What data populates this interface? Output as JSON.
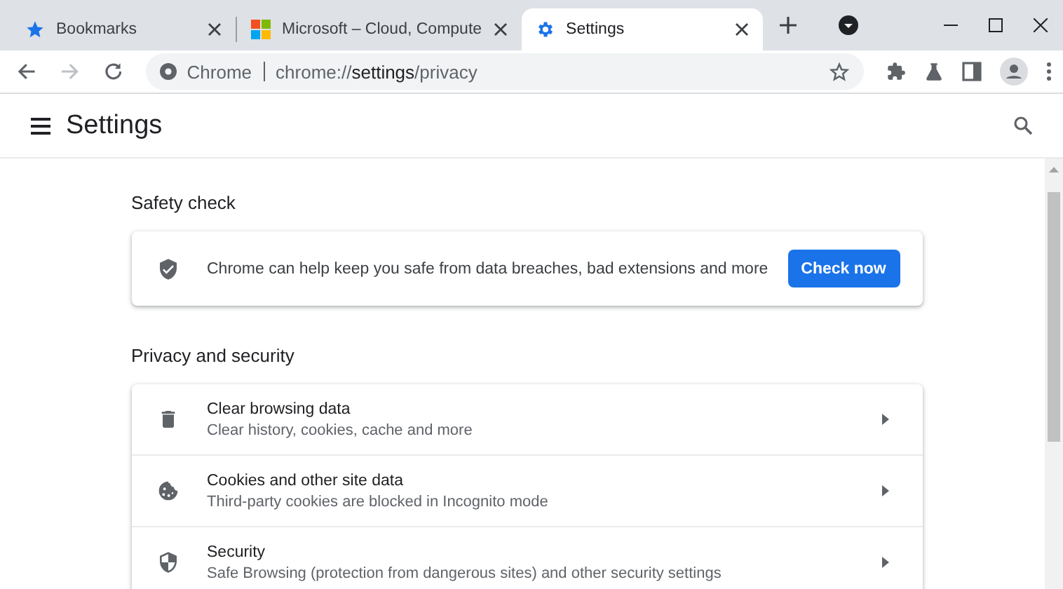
{
  "tabs": [
    {
      "title": "Bookmarks",
      "selected": false
    },
    {
      "title": "Microsoft – Cloud, Compute",
      "selected": false
    },
    {
      "title": "Settings",
      "selected": true
    }
  ],
  "toolbar": {
    "forward_disabled": true,
    "site_label": "Chrome",
    "url": "chrome://**settings**/privacy"
  },
  "page_title": "Settings",
  "sections": [
    {
      "kind": "safety",
      "heading": "Safety check",
      "text": "Chrome can help keep you safe from data breaches, bad extensions and more",
      "button": "Check now"
    },
    {
      "kind": "list",
      "heading": "Privacy and security",
      "items": [
        {
          "title": "Clear browsing data",
          "subtitle": "Clear history, cookies, cache and more"
        },
        {
          "title": "Cookies and other site data",
          "subtitle": "Third-party cookies are blocked in Incognito mode"
        },
        {
          "title": "Security",
          "subtitle": "Safe Browsing (protection from dangerous sites) and other security settings"
        }
      ]
    }
  ]
}
